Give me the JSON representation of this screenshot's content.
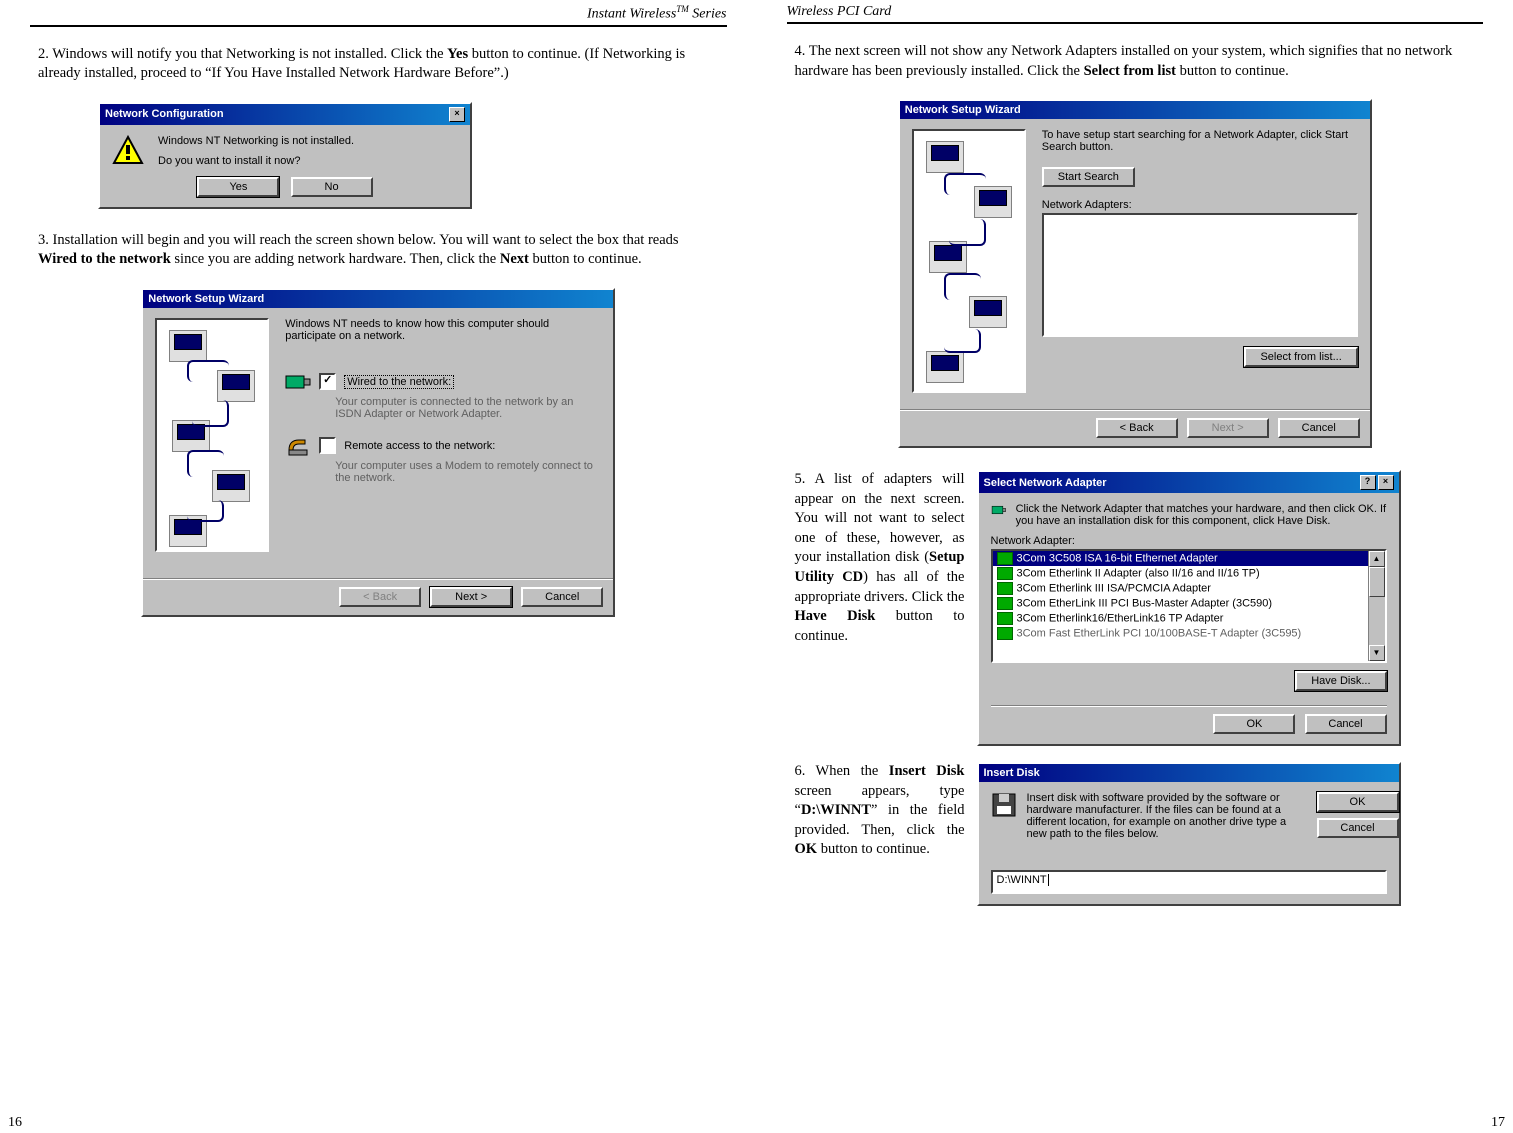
{
  "left": {
    "header": "Instant Wireless",
    "header_tm": "TM",
    "header_suffix": " Series",
    "page_num": "16",
    "step2_a": "2. Windows will notify you that Networking is not installed. Click the ",
    "step2_b": "Yes",
    "step2_c": " button to continue. (If Networking is already installed, proceed to “If You Have Installed Network Hardware Before”.)",
    "dlg1": {
      "title": "Network Configuration",
      "line1": "Windows NT Networking is not installed.",
      "line2": "Do you want to install it now?",
      "yes": "Yes",
      "no": "No"
    },
    "step3_a": "3. Installation will begin and you will reach the screen shown below. You will want to select the box that reads ",
    "step3_b": "Wired to the network",
    "step3_c": " since you are adding network hardware. Then, click the ",
    "step3_d": "Next",
    "step3_e": " button to continue.",
    "dlg2": {
      "title": "Network Setup Wizard",
      "intro": "Windows NT needs to know how this computer should participate on a network.",
      "opt1_label": "Wired to the network:",
      "opt1_desc": "Your computer is connected to the network by an ISDN Adapter or Network Adapter.",
      "opt2_label": "Remote access to the network:",
      "opt2_desc": "Your computer uses a Modem to remotely connect to the network.",
      "back": "< Back",
      "next": "Next >",
      "cancel": "Cancel"
    }
  },
  "right": {
    "header": "Wireless PCI Card",
    "page_num": "17",
    "step4_a": "4. The next screen will not show any Network Adapters installed on your system, which signifies that no network hardware has been previously installed. Click the ",
    "step4_b": "Select from list",
    "step4_c": " button to continue.",
    "dlg3": {
      "title": "Network Setup Wizard",
      "intro": "To have setup start searching for a Network Adapter, click Start Search button.",
      "start": "Start Search",
      "adapters_label": "Network Adapters:",
      "select": "Select from list...",
      "back": "< Back",
      "next": "Next >",
      "cancel": "Cancel"
    },
    "step5_a": "5. A list of adapters will appear on the next screen. You will not want to select one of these, however, as your installation disk (",
    "step5_b": "Setup Utility CD",
    "step5_c": ") has all of the appropriate drivers. Click the ",
    "step5_d": "Have Disk",
    "step5_e": " button to continue.",
    "dlg4": {
      "title": "Select Network Adapter",
      "intro": "Click the Network Adapter that matches your hardware, and then click OK. If you have an installation disk for this component, click Have Disk.",
      "label": "Network Adapter:",
      "items": [
        "3Com 3C508 ISA 16-bit Ethernet Adapter",
        "3Com Etherlink II Adapter (also II/16 and II/16 TP)",
        "3Com Etherlink III ISA/PCMCIA Adapter",
        "3Com EtherLink III PCI Bus-Master Adapter (3C590)",
        "3Com Etherlink16/EtherLink16 TP Adapter",
        "3Com Fast EtherLink PCI 10/100BASE-T Adapter (3C595)"
      ],
      "have_disk": "Have Disk...",
      "ok": "OK",
      "cancel": "Cancel"
    },
    "step6_a": "6. When the ",
    "step6_b": "Insert Disk",
    "step6_c": " screen appears, type “",
    "step6_d": "D:\\WINNT",
    "step6_e": "” in the field provided. Then, click the ",
    "step6_f": "OK",
    "step6_g": " button to continue.",
    "dlg5": {
      "title": "Insert Disk",
      "text": "Insert disk with software provided by the software or hardware manufacturer. If the files can be found at a different location, for example on another drive type a new path to the files below.",
      "ok": "OK",
      "cancel": "Cancel",
      "value": "D:\\WINNT"
    }
  }
}
